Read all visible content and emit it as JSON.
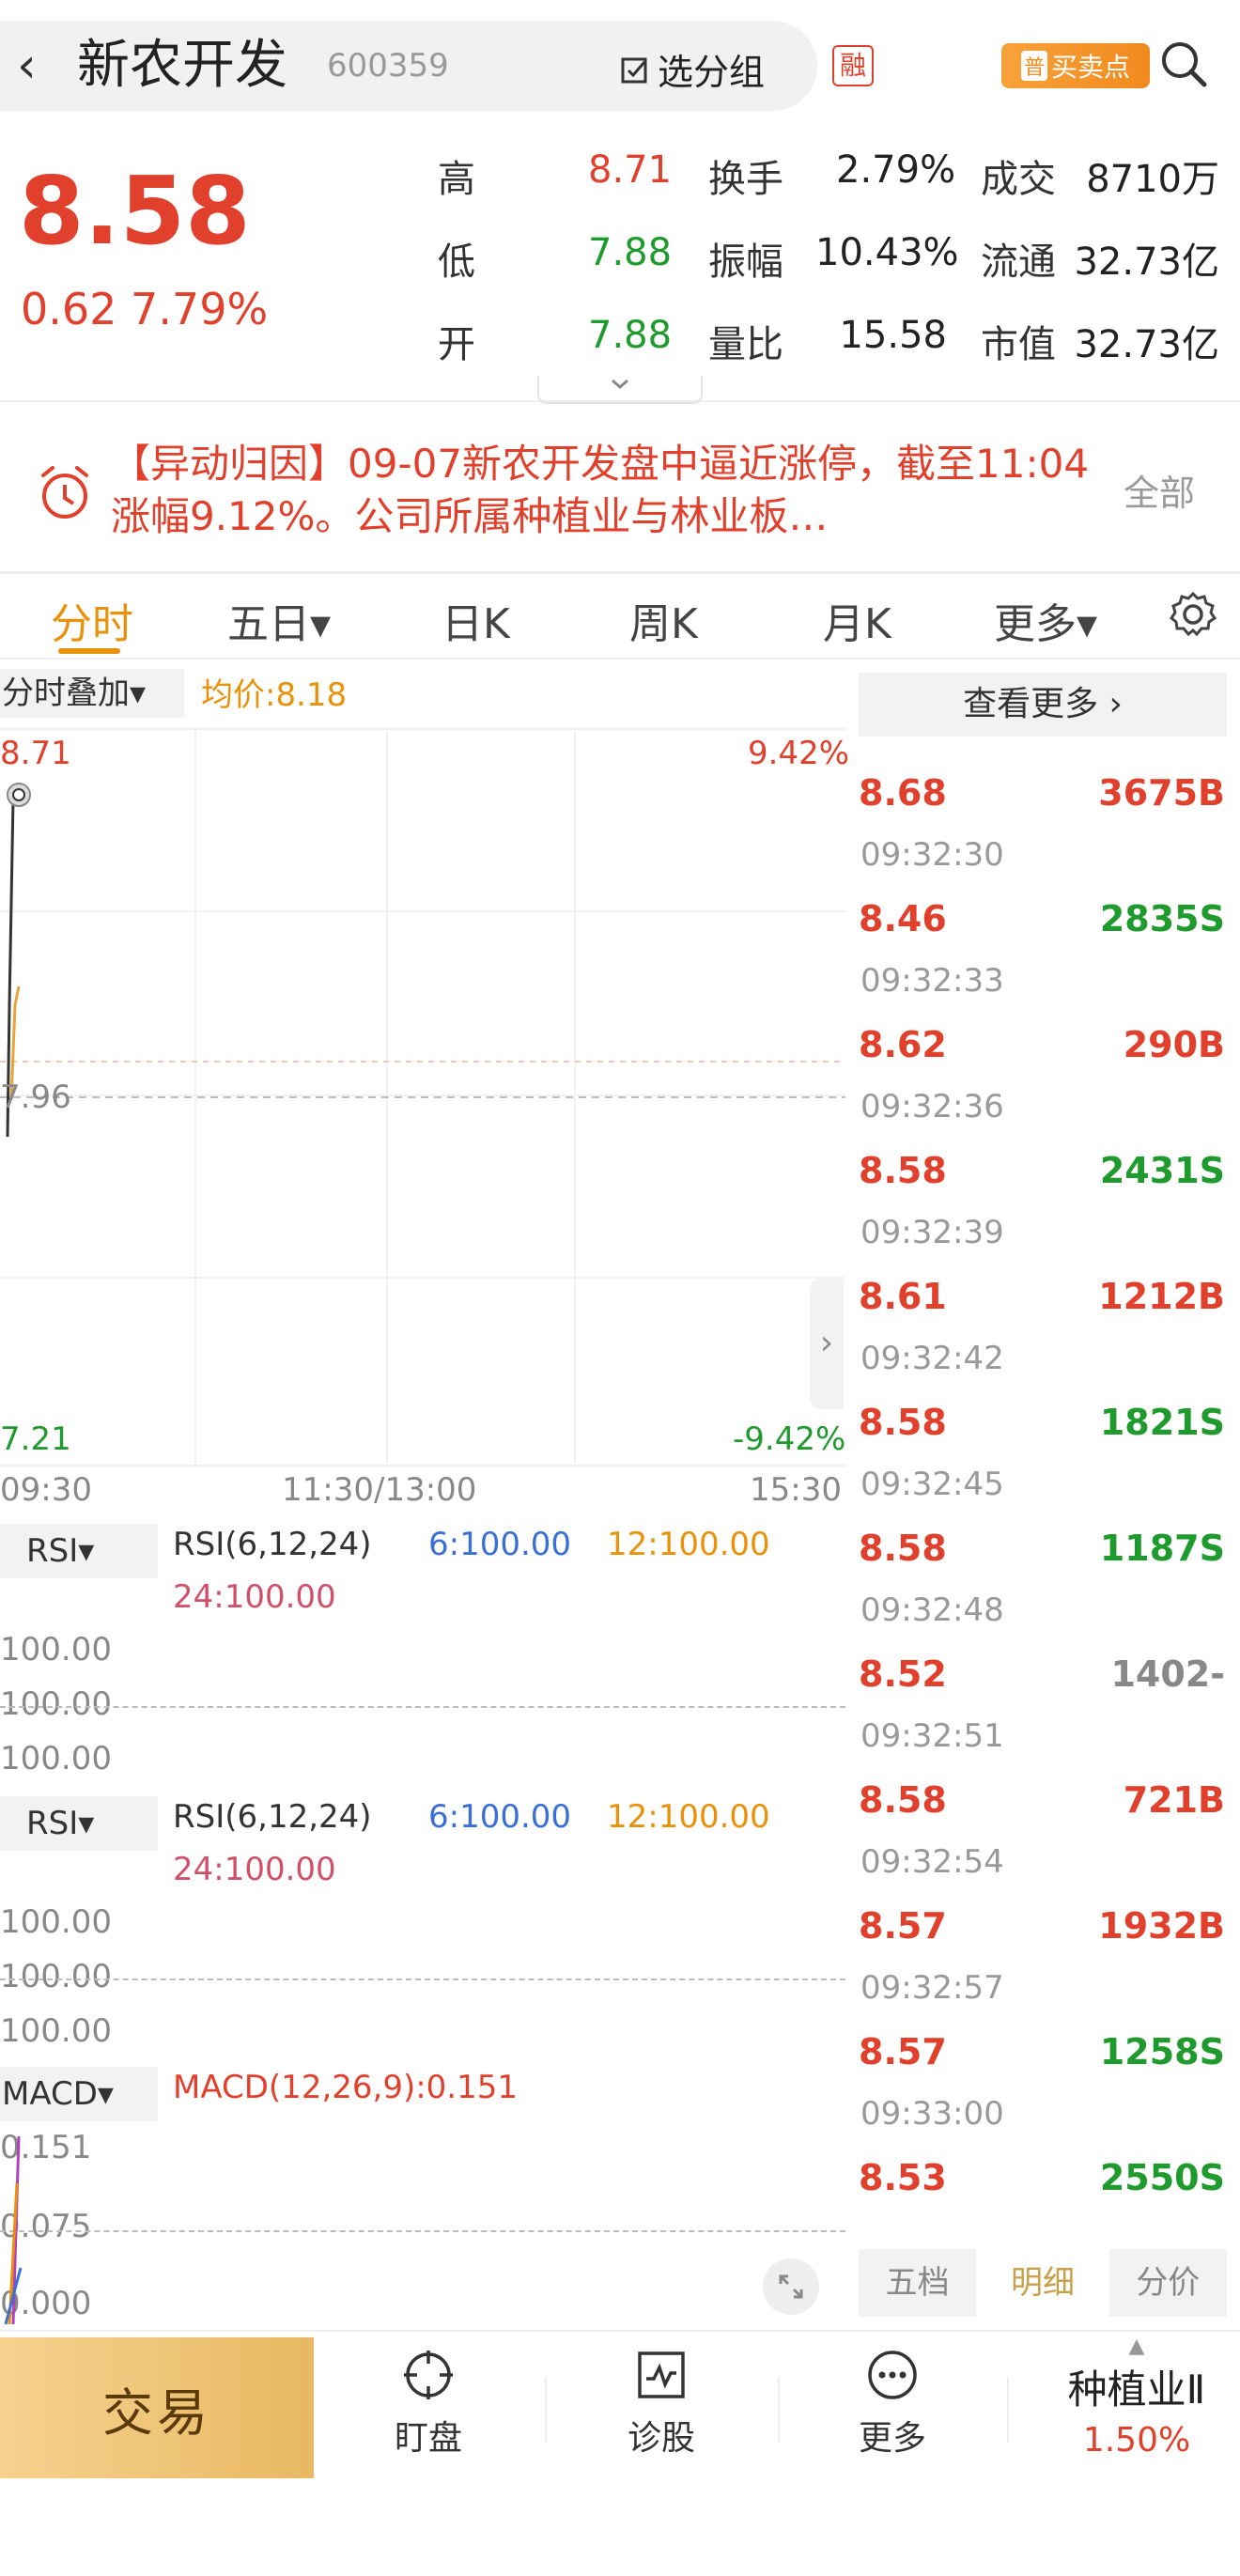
{
  "header": {
    "back": "‹",
    "title": "新农开发",
    "code": "600359",
    "group_btn": "选分组",
    "rong": "融",
    "bsp_tag": "普",
    "bsp_label": "买卖点"
  },
  "quote": {
    "price": "8.58",
    "change": "0.62",
    "change_pct": "7.79%",
    "rows": [
      {
        "l1": "高",
        "v1": "8.71",
        "c1": "red",
        "l2": "换手",
        "v2": "2.79%",
        "l3": "成交",
        "v3": "8710万"
      },
      {
        "l1": "低",
        "v1": "7.88",
        "c1": "green",
        "l2": "振幅",
        "v2": "10.43%",
        "l3": "流通",
        "v3": "32.73亿"
      },
      {
        "l1": "开",
        "v1": "7.88",
        "c1": "green",
        "l2": "量比",
        "v2": "15.58",
        "l3": "市值",
        "v3": "32.73亿"
      }
    ],
    "expand_icon": "chevron-down"
  },
  "news": {
    "text": "【异动归因】09-07新农开发盘中逼近涨停，截至11:04涨幅9.12%。公司所属种植业与林业板…",
    "all": "全部"
  },
  "tabs": [
    {
      "label": "分时",
      "active": true
    },
    {
      "label": "五日▾"
    },
    {
      "label": "日K"
    },
    {
      "label": "周K"
    },
    {
      "label": "月K"
    },
    {
      "label": "更多▾"
    }
  ],
  "chart": {
    "overlay_btn": "分时叠加▾",
    "avg_label": "均价:8.18",
    "high": "8.71",
    "high_pct": "9.42%",
    "mid": "7.96",
    "low": "7.21",
    "low_pct": "-9.42%",
    "times": [
      "09:30",
      "11:30/13:00",
      "15:30"
    ],
    "expand_arrow": "›"
  },
  "rsi_panels": [
    {
      "name": "RSI▾",
      "params": "RSI(6,12,24)",
      "v6": "6:100.00",
      "v12": "12:100.00",
      "v24": "24:100.00",
      "ticks": [
        "100.00",
        "100.00",
        "100.00"
      ]
    },
    {
      "name": "RSI▾",
      "params": "RSI(6,12,24)",
      "v6": "6:100.00",
      "v12": "12:100.00",
      "v24": "24:100.00",
      "ticks": [
        "100.00",
        "100.00",
        "100.00"
      ]
    }
  ],
  "macd": {
    "name": "MACD▾",
    "label": "MACD(12,26,9):0.151",
    "ticks": [
      "0.151",
      "0.075",
      "0.000"
    ]
  },
  "trades": {
    "more": "查看更多 ›",
    "rows": [
      {
        "time": "",
        "price": "8.68",
        "vol": "3675B",
        "pc": "red",
        "vc": "red"
      },
      {
        "time": "09:32:30",
        "price": "8.46",
        "vol": "2835S",
        "pc": "red",
        "vc": "green"
      },
      {
        "time": "09:32:33",
        "price": "8.62",
        "vol": "290B",
        "pc": "red",
        "vc": "red"
      },
      {
        "time": "09:32:36",
        "price": "8.58",
        "vol": "2431S",
        "pc": "red",
        "vc": "green"
      },
      {
        "time": "09:32:39",
        "price": "8.61",
        "vol": "1212B",
        "pc": "red",
        "vc": "red"
      },
      {
        "time": "09:32:42",
        "price": "8.58",
        "vol": "1821S",
        "pc": "red",
        "vc": "green"
      },
      {
        "time": "09:32:45",
        "price": "8.58",
        "vol": "1187S",
        "pc": "red",
        "vc": "green"
      },
      {
        "time": "09:32:48",
        "price": "8.52",
        "vol": "1402-",
        "pc": "red",
        "vc": "gray"
      },
      {
        "time": "09:32:51",
        "price": "8.58",
        "vol": "721B",
        "pc": "red",
        "vc": "red"
      },
      {
        "time": "09:32:54",
        "price": "8.57",
        "vol": "1932B",
        "pc": "red",
        "vc": "red"
      },
      {
        "time": "09:32:57",
        "price": "8.57",
        "vol": "1258S",
        "pc": "red",
        "vc": "green"
      },
      {
        "time": "09:33:00",
        "price": "8.53",
        "vol": "2550S",
        "pc": "red",
        "vc": "green"
      }
    ],
    "tabs": [
      "五档",
      "明细",
      "分价"
    ]
  },
  "bottom": {
    "trade": "交易",
    "items": [
      "盯盘",
      "诊股",
      "更多"
    ],
    "sector": "种植业Ⅱ",
    "sector_pct": "1.50%"
  }
}
